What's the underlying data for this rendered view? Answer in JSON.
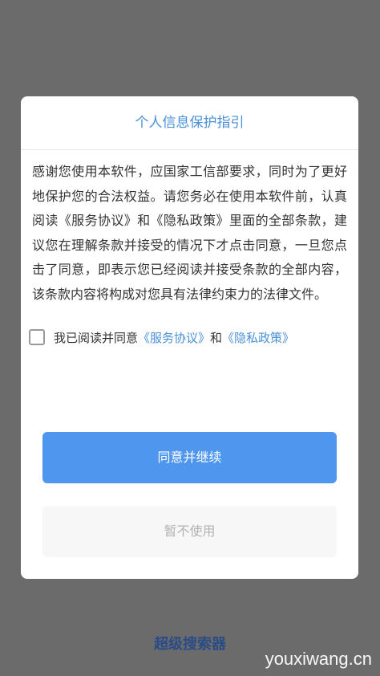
{
  "dialog": {
    "title": "个人信息保护指引",
    "body_text": "感谢您使用本软件，应国家工信部要求，同时为了更好地保护您的合法权益。请您务必在使用本软件前，认真阅读《服务协议》和《隐私政策》里面的全部条款，建议您在理解条款并接受的情况下才点击同意，一旦您点击了同意，即表示您已经阅读并接受条款的全部内容，该条款内容将构成对您具有法律约束力的法律文件。",
    "agree": {
      "checked": false,
      "prefix": "我已阅读并同意",
      "service_link": "《服务协议》",
      "conjunction": "和",
      "privacy_link": "《隐私政策》"
    },
    "accept_button": "同意并继续",
    "decline_button": "暂不使用"
  },
  "app_name": "超级搜索器",
  "watermark": "youxiwang.cn",
  "colors": {
    "overlay": "#6b6b6b",
    "accent": "#4a90d9",
    "primary_button": "#4f96ee",
    "app_name": "#2b4b86"
  }
}
